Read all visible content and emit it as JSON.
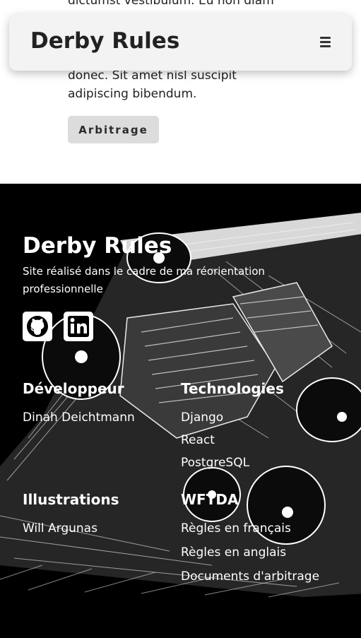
{
  "main": {
    "paragraph_top": "dictumst vestibulum. Eu non diam",
    "paragraph_bottom": "donec. Sit amet nisl suscipit adipiscing bibendum.",
    "tag_label": "Arbitrage"
  },
  "header": {
    "title": "Derby Rules",
    "menu_icon": "hamburger-menu-icon"
  },
  "footer": {
    "title": "Derby Rules",
    "tagline": "Site réalisé dans le cadre de ma réorientation professionnelle",
    "social": {
      "github_icon": "github-icon",
      "linkedin_icon": "linkedin-icon"
    },
    "developer": {
      "heading": "Développeur",
      "items": [
        "Dinah Deichtmann"
      ]
    },
    "technologies": {
      "heading": "Technologies",
      "items": [
        "Django",
        "React",
        "PostgreSQL"
      ]
    },
    "illustrations": {
      "heading": "Illustrations",
      "items": [
        "Will Argunas"
      ]
    },
    "wftda": {
      "heading": "WFTDA",
      "items": [
        "Règles en français",
        "Règles en anglais",
        "Documents d'arbitrage"
      ]
    }
  },
  "colors": {
    "footer_bg": "#000000",
    "header_bg": "#f3f3f3",
    "tag_bg": "#dcdcdc",
    "text_dark": "#222222"
  }
}
